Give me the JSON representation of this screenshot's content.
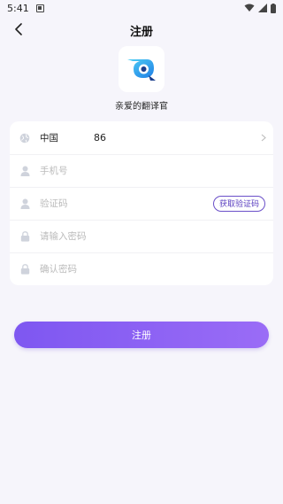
{
  "status_bar": {
    "time": "5:41"
  },
  "header": {
    "title": "注册"
  },
  "app": {
    "name": "亲爱的翻译官"
  },
  "form": {
    "region": {
      "country": "中国",
      "code": "86"
    },
    "phone": {
      "placeholder": "手机号"
    },
    "verify": {
      "placeholder": "验证码",
      "button_label": "获取验证码"
    },
    "password": {
      "placeholder": "请输入密码"
    },
    "confirm": {
      "placeholder": "确认密码"
    }
  },
  "actions": {
    "register_label": "注册"
  },
  "colors": {
    "accent": "#7e57f1",
    "background": "#f6f5fb",
    "logo_blue": "#2aa6f0"
  }
}
